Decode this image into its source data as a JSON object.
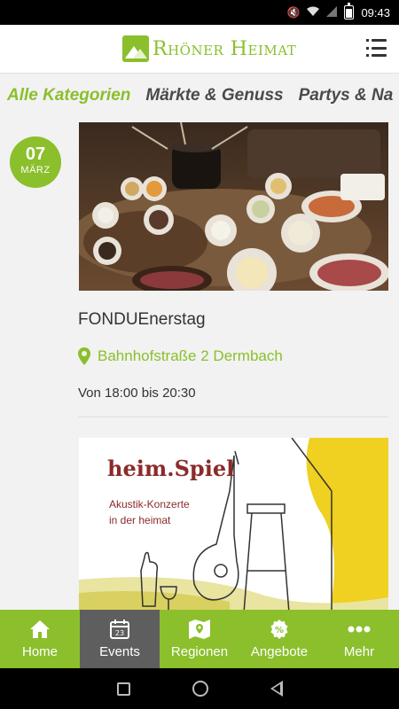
{
  "status_bar": {
    "time": "09:43"
  },
  "header": {
    "logo_text": "Rhöner Heimat"
  },
  "categories": [
    "Alle Kategorien",
    "Märkte & Genuss",
    "Partys & Na"
  ],
  "events": [
    {
      "day": "07",
      "month": "MÄRZ",
      "title": "FONDUEnerstag",
      "location": "Bahnhofstraße 2 Dermbach",
      "time": "Von  18:00 bis 20:30"
    },
    {
      "image_title": "heim.Spiel",
      "image_subtitle_1": "Akustik-Konzerte",
      "image_subtitle_2": "in der heimat"
    }
  ],
  "bottom_nav": [
    {
      "label": "Home",
      "icon": "home-icon"
    },
    {
      "label": "Events",
      "icon": "calendar-icon",
      "badge": "23"
    },
    {
      "label": "Regionen",
      "icon": "map-icon"
    },
    {
      "label": "Angebote",
      "icon": "percent-icon"
    },
    {
      "label": "Mehr",
      "icon": "more-icon"
    }
  ],
  "colors": {
    "accent": "#8bbf2c",
    "active_tab": "#5e5e5e",
    "text": "#333333"
  }
}
